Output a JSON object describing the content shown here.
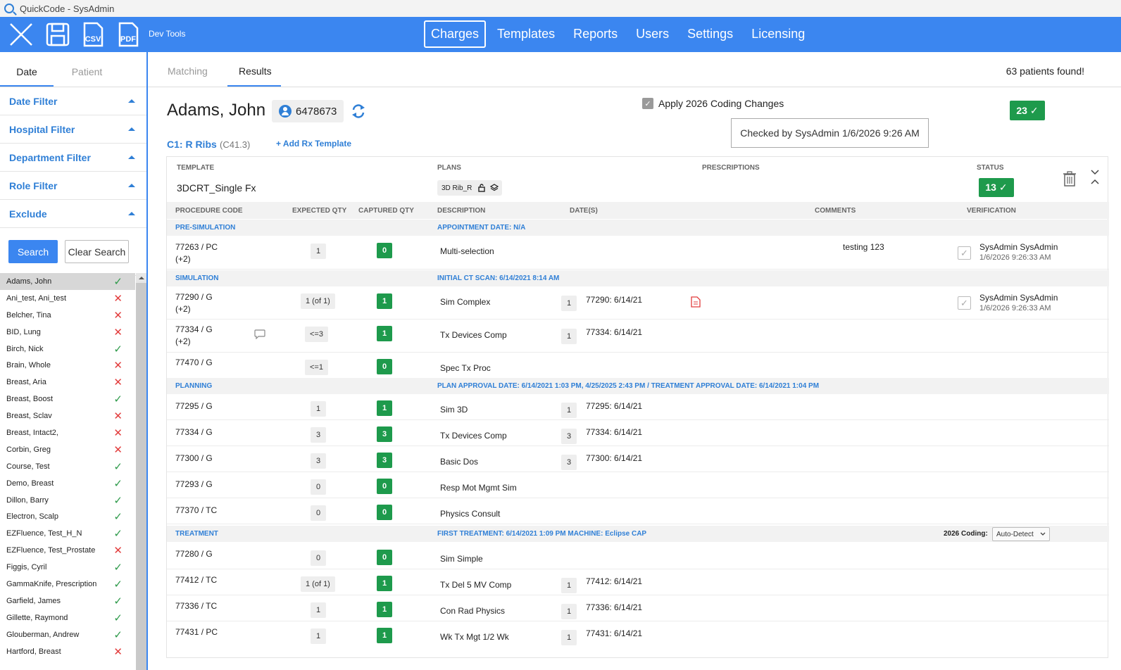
{
  "window": {
    "title": "QuickCode - SysAdmin"
  },
  "toolbar": {
    "icons": [
      "close-icon",
      "save-icon",
      "csv-icon",
      "pdf-icon"
    ],
    "csv_label": "CSV",
    "pdf_label": "PDF",
    "dev_tools": "Dev Tools",
    "nav": [
      "Charges",
      "Templates",
      "Reports",
      "Users",
      "Settings",
      "Licensing"
    ],
    "active_nav": "Charges",
    "accent": "#3b86f0"
  },
  "left": {
    "tabs": [
      "Date",
      "Patient"
    ],
    "active_tab": "Date",
    "filters": [
      "Date Filter",
      "Hospital Filter",
      "Department Filter",
      "Role Filter",
      "Exclude"
    ],
    "search_label": "Search",
    "clear_label": "Clear Search",
    "patients": [
      {
        "name": "Adams, John",
        "ok": true,
        "selected": true
      },
      {
        "name": "Ani_test, Ani_test",
        "ok": false
      },
      {
        "name": "Belcher, Tina",
        "ok": false
      },
      {
        "name": "BID, Lung",
        "ok": false
      },
      {
        "name": "Birch, Nick",
        "ok": true
      },
      {
        "name": "Brain, Whole",
        "ok": false
      },
      {
        "name": "Breast, Aria",
        "ok": false
      },
      {
        "name": "Breast, Boost",
        "ok": true
      },
      {
        "name": "Breast, Sclav",
        "ok": false
      },
      {
        "name": "Breast, Intact2,",
        "ok": false
      },
      {
        "name": "Corbin, Greg",
        "ok": false
      },
      {
        "name": "Course, Test",
        "ok": true
      },
      {
        "name": "Demo, Breast",
        "ok": true
      },
      {
        "name": "Dillon, Barry",
        "ok": true
      },
      {
        "name": "Electron, Scalp",
        "ok": true
      },
      {
        "name": "EZFluence, Test_H_N",
        "ok": true
      },
      {
        "name": "EZFluence, Test_Prostate",
        "ok": false
      },
      {
        "name": "Figgis, Cyril",
        "ok": true
      },
      {
        "name": "GammaKnife, Prescription",
        "ok": true
      },
      {
        "name": "Garfield, James",
        "ok": true
      },
      {
        "name": "Gillette, Raymond",
        "ok": true
      },
      {
        "name": "Glouberman, Andrew",
        "ok": true
      },
      {
        "name": "Hartford, Breast",
        "ok": false
      }
    ]
  },
  "right": {
    "tabs": [
      "Matching",
      "Results"
    ],
    "active_tab": "Results",
    "found_text": "63 patients found!",
    "patient_name": "Adams, John",
    "patient_id": "6478673",
    "apply_label": "Apply 2026 Coding Changes",
    "checked_by": "Checked by SysAdmin 1/6/2026 9:26 AM",
    "status_count": "23 ✓",
    "dx_label": "C1: R Ribs",
    "dx_code": "(C41.3)",
    "add_rx": "+ Add Rx Template"
  },
  "card": {
    "hdr_template": "TEMPLATE",
    "hdr_plans": "PLANS",
    "hdr_prescriptions": "PRESCRIPTIONS",
    "hdr_status": "STATUS",
    "template_name": "3DCRT_Single Fx",
    "plan_chip": "3D Rib_R",
    "status_badge": "13 ✓",
    "columns": {
      "code": "PROCEDURE CODE",
      "expected": "EXPECTED QTY",
      "captured": "CAPTURED QTY",
      "description": "DESCRIPTION",
      "dates": "DATE(S)",
      "comments": "COMMENTS",
      "verification": "VERIFICATION"
    },
    "sections": {
      "presim": {
        "name": "PRE-SIMULATION",
        "info": "APPOINTMENT DATE: N/A"
      },
      "sim": {
        "name": "SIMULATION",
        "info": "INITIAL CT SCAN:  6/14/2021 8:14 AM"
      },
      "planning": {
        "name": "PLANNING",
        "info": "PLAN APPROVAL DATE: 6/14/2021 1:03 PM, 4/25/2025 2:43 PM  /  TREATMENT APPROVAL DATE: 6/14/2021 1:04 PM"
      },
      "treatment": {
        "name": "TREATMENT",
        "info": "FIRST TREATMENT: 6/14/2021 1:09 PM  MACHINE: Eclipse CAP",
        "coding_label": "2026 Coding:",
        "coding_value": "Auto-Detect"
      }
    },
    "rows": {
      "r77263": {
        "code": "77263 / PC",
        "extra": "(+2)",
        "expected": "1",
        "captured": "0",
        "desc": "Multi-selection",
        "comment": "testing 123",
        "ver_name": "SysAdmin SysAdmin",
        "ver_date": "1/6/2026 9:26:33 AM"
      },
      "r77290": {
        "code": "77290 / G",
        "extra": "(+2)",
        "expected": "1 (of 1)",
        "captured": "1",
        "desc": "Sim Complex",
        "dqty": "1",
        "date": "77290: 6/14/21",
        "ver_name": "SysAdmin SysAdmin",
        "ver_date": "1/6/2026 9:26:33 AM"
      },
      "r77334a": {
        "code": "77334 / G",
        "extra": "(+2)",
        "expected": "<=3",
        "captured": "1",
        "desc": "Tx Devices Comp",
        "dqty": "1",
        "date": "77334: 6/14/21"
      },
      "r77470": {
        "code": "77470 / G",
        "expected": "<=1",
        "captured": "0",
        "desc": "Spec Tx Proc"
      },
      "r77295": {
        "code": "77295 / G",
        "expected": "1",
        "captured": "1",
        "desc": "Sim 3D",
        "dqty": "1",
        "date": "77295: 6/14/21"
      },
      "r77334b": {
        "code": "77334 / G",
        "expected": "3",
        "captured": "3",
        "desc": "Tx Devices Comp",
        "dqty": "3",
        "date": "77334: 6/14/21"
      },
      "r77300": {
        "code": "77300 / G",
        "expected": "3",
        "captured": "3",
        "desc": "Basic Dos",
        "dqty": "3",
        "date": "77300: 6/14/21"
      },
      "r77293": {
        "code": "77293 / G",
        "expected": "0",
        "captured": "0",
        "desc": "Resp Mot Mgmt Sim"
      },
      "r77370": {
        "code": "77370 / TC",
        "expected": "0",
        "captured": "0",
        "desc": "Physics Consult"
      },
      "r77280": {
        "code": "77280 / G",
        "expected": "0",
        "captured": "0",
        "desc": "Sim Simple"
      },
      "r77412": {
        "code": "77412 / TC",
        "expected": "1 (of 1)",
        "captured": "1",
        "desc": "Tx Del 5 MV Comp",
        "dqty": "1",
        "date": "77412: 6/14/21"
      },
      "r77336": {
        "code": "77336 / TC",
        "expected": "1",
        "captured": "1",
        "desc": "Con Rad Physics",
        "dqty": "1",
        "date": "77336: 6/14/21"
      },
      "r77431": {
        "code": "77431 / PC",
        "expected": "1",
        "captured": "1",
        "desc": "Wk Tx Mgt 1/2 Wk",
        "dqty": "1",
        "date": "77431: 6/14/21"
      }
    },
    "status_green": "#1e9a4c"
  }
}
